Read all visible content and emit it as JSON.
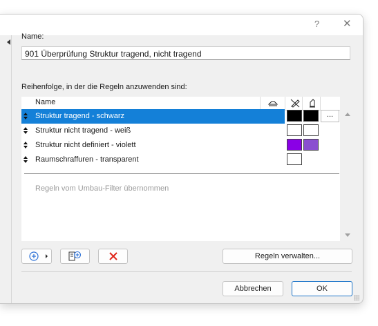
{
  "window": {
    "help_label": "?",
    "close_label": "✕"
  },
  "name_field": {
    "label": "Name:",
    "value": "901 Überprüfung Struktur tragend, nicht tragend"
  },
  "rules": {
    "label": "Reihenfolge, in der die Regeln anzuwenden sind:",
    "column_name": "Name",
    "column_icons": [
      "surface-icon",
      "override-pen-icon",
      "fill-bucket-icon"
    ],
    "items": [
      {
        "name": "Struktur tragend - schwarz",
        "selected": true,
        "swatch1": "#000000",
        "swatch2": "#000000",
        "more": "..."
      },
      {
        "name": "Struktur nicht tragend - weiß",
        "selected": false,
        "swatch1": "#ffffff",
        "swatch2": "#ffffff"
      },
      {
        "name": "Struktur nicht definiert - violett",
        "selected": false,
        "swatch1": "#8a00e6",
        "swatch2": "#8a4fd0"
      },
      {
        "name": "Raumschraffuren - transparent",
        "selected": false,
        "swatch1": "#ffffff"
      }
    ],
    "inherited_hint": "Regeln vom Umbau-Filter übernommen"
  },
  "toolbar": {
    "add_icon": "plus-circle-icon",
    "import_icon": "import-rules-icon",
    "delete_icon": "red-x-icon",
    "manage_label": "Regeln verwalten..."
  },
  "footer": {
    "cancel_label": "Abbrechen",
    "ok_label": "OK"
  },
  "colors": {
    "selection": "#1480d8",
    "accent": "#1a73c8",
    "delete": "#e0261b",
    "add": "#2a6fd6"
  }
}
